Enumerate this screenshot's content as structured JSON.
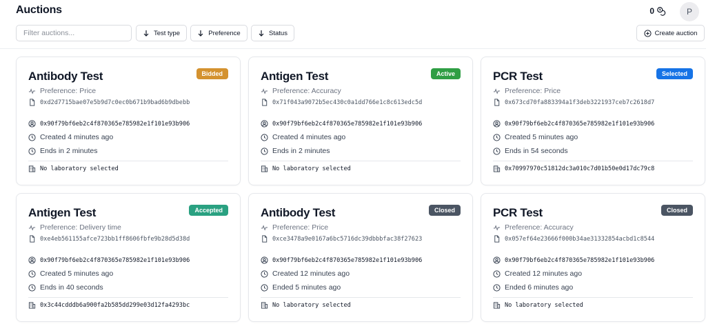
{
  "header": {
    "title": "Auctions",
    "wallet_balance": "0",
    "avatar_initial": "P"
  },
  "toolbar": {
    "filter_placeholder": "Filter auctions...",
    "sort_test_type": "Test type",
    "sort_preference": "Preference",
    "sort_status": "Status",
    "create_label": "Create auction"
  },
  "colors": {
    "Bidded": "#d4922f",
    "Active": "#2f9e44",
    "Selected": "#1673e6",
    "Accepted": "#2aa181",
    "Closed": "#4b5563"
  },
  "auctions": [
    {
      "title": "Antibody Test",
      "status": "Bidded",
      "preference": "Preference: Price",
      "file_hash": "0xd2d7715bae07e5b9d7c0ec0b671b9bad6b9dbebb",
      "owner": "0x90f79bf6eb2c4f870365e785982e1f101e93b906",
      "created": "Created 4 minutes ago",
      "ends": "Ends in 2 minutes",
      "laboratory": "No laboratory selected"
    },
    {
      "title": "Antigen Test",
      "status": "Active",
      "preference": "Preference: Accuracy",
      "file_hash": "0x71f043a9072b5ec430c0a1dd766e1c8c613edc5d",
      "owner": "0x90f79bf6eb2c4f870365e785982e1f101e93b906",
      "created": "Created 4 minutes ago",
      "ends": "Ends in 2 minutes",
      "laboratory": "No laboratory selected"
    },
    {
      "title": "PCR Test",
      "status": "Selected",
      "preference": "Preference: Price",
      "file_hash": "0x673cd70fa883394a1f3deb3221937ceb7c2618d7",
      "owner": "0x90f79bf6eb2c4f870365e785982e1f101e93b906",
      "created": "Created 5 minutes ago",
      "ends": "Ends in 54 seconds",
      "laboratory": "0x70997970c51812dc3a010c7d01b50e0d17dc79c8"
    },
    {
      "title": "Antigen Test",
      "status": "Accepted",
      "preference": "Preference: Delivery time",
      "file_hash": "0xe4eb561155afce723bb1ff8606fbfe9b28d5d38d",
      "owner": "0x90f79bf6eb2c4f870365e785982e1f101e93b906",
      "created": "Created 5 minutes ago",
      "ends": "Ends in 40 seconds",
      "laboratory": "0x3c44cdddb6a900fa2b585dd299e03d12fa4293bc"
    },
    {
      "title": "Antibody Test",
      "status": "Closed",
      "preference": "Preference: Price",
      "file_hash": "0xce3478a9e0167a6bc5716dc39dbbbfac38f27623",
      "owner": "0x90f79bf6eb2c4f870365e785982e1f101e93b906",
      "created": "Created 12 minutes ago",
      "ends": "Ended 5 minutes ago",
      "laboratory": "No laboratory selected"
    },
    {
      "title": "PCR Test",
      "status": "Closed",
      "preference": "Preference: Accuracy",
      "file_hash": "0x057ef64e23666f000b34ae31332854acbd1c8544",
      "owner": "0x90f79bf6eb2c4f870365e785982e1f101e93b906",
      "created": "Created 12 minutes ago",
      "ends": "Ended 6 minutes ago",
      "laboratory": "No laboratory selected"
    }
  ]
}
